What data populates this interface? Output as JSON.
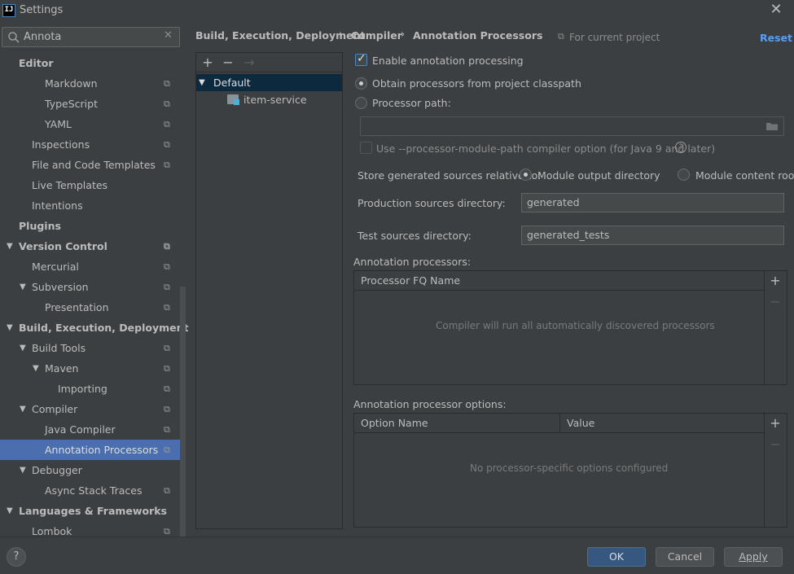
{
  "window": {
    "title": "Settings",
    "app_icon_text": "IJ"
  },
  "search": {
    "value": "Annota",
    "placeholder": ""
  },
  "sidebar": {
    "items": [
      {
        "label": "Editor",
        "bold": true,
        "level": 0,
        "arrow": "",
        "copy": false
      },
      {
        "label": "Markdown",
        "bold": false,
        "level": 2,
        "arrow": "",
        "copy": true
      },
      {
        "label": "TypeScript",
        "bold": false,
        "level": 2,
        "arrow": "",
        "copy": true
      },
      {
        "label": "YAML",
        "bold": false,
        "level": 2,
        "arrow": "",
        "copy": true
      },
      {
        "label": "Inspections",
        "bold": false,
        "level": 1,
        "arrow": "",
        "copy": true
      },
      {
        "label": "File and Code Templates",
        "bold": false,
        "level": 1,
        "arrow": "",
        "copy": true
      },
      {
        "label": "Live Templates",
        "bold": false,
        "level": 1,
        "arrow": "",
        "copy": false
      },
      {
        "label": "Intentions",
        "bold": false,
        "level": 1,
        "arrow": "",
        "copy": false
      },
      {
        "label": "Plugins",
        "bold": true,
        "level": 0,
        "arrow": "",
        "copy": false
      },
      {
        "label": "Version Control",
        "bold": true,
        "level": 0,
        "arrow": "▼",
        "copy": true
      },
      {
        "label": "Mercurial",
        "bold": false,
        "level": 1,
        "arrow": "",
        "copy": true
      },
      {
        "label": "Subversion",
        "bold": false,
        "level": 1,
        "arrow": "▼",
        "copy": true
      },
      {
        "label": "Presentation",
        "bold": false,
        "level": 2,
        "arrow": "",
        "copy": true
      },
      {
        "label": "Build, Execution, Deployment",
        "bold": true,
        "level": 0,
        "arrow": "▼",
        "copy": false
      },
      {
        "label": "Build Tools",
        "bold": false,
        "level": 1,
        "arrow": "▼",
        "copy": true
      },
      {
        "label": "Maven",
        "bold": false,
        "level": 2,
        "arrow": "▼",
        "copy": true
      },
      {
        "label": "Importing",
        "bold": false,
        "level": 3,
        "arrow": "",
        "copy": true
      },
      {
        "label": "Compiler",
        "bold": false,
        "level": 1,
        "arrow": "▼",
        "copy": true
      },
      {
        "label": "Java Compiler",
        "bold": false,
        "level": 2,
        "arrow": "",
        "copy": true
      },
      {
        "label": "Annotation Processors",
        "bold": false,
        "level": 2,
        "arrow": "",
        "copy": true,
        "selected": true
      },
      {
        "label": "Debugger",
        "bold": false,
        "level": 1,
        "arrow": "▼",
        "copy": false
      },
      {
        "label": "Async Stack Traces",
        "bold": false,
        "level": 2,
        "arrow": "",
        "copy": true
      },
      {
        "label": "Languages & Frameworks",
        "bold": true,
        "level": 0,
        "arrow": "▼",
        "copy": false
      },
      {
        "label": "Lombok",
        "bold": false,
        "level": 1,
        "arrow": "",
        "copy": true
      }
    ]
  },
  "breadcrumb": {
    "items": [
      "Build, Execution, Deployment",
      "Compiler",
      "Annotation Processors"
    ],
    "separator": "›",
    "scope_label": "For current project",
    "reset_label": "Reset"
  },
  "profiles": {
    "toolbar": {
      "add": "+",
      "remove": "−",
      "move": "→"
    },
    "default_label": "Default",
    "module_label": "item-service"
  },
  "options": {
    "enable_label": "Enable annotation processing",
    "enable_checked": true,
    "obtain_label": "Obtain processors from project classpath",
    "processor_path_label": "Processor path:",
    "processor_path_value": "",
    "module_path_label": "Use --processor-module-path compiler option (for Java 9 and later)",
    "store_label": "Store generated sources relative to:",
    "store_option_1": "Module output directory",
    "store_option_2": "Module content root",
    "production_label": "Production sources directory:",
    "production_value": "generated",
    "test_label": "Test sources directory:",
    "test_value": "generated_tests"
  },
  "processors_table": {
    "title": "Annotation processors:",
    "column": "Processor FQ Name",
    "empty_text": "Compiler will run all automatically discovered processors"
  },
  "options_table": {
    "title": "Annotation processor options:",
    "columns": [
      "Option Name",
      "Value"
    ],
    "empty_text": "No processor-specific options configured"
  },
  "footer": {
    "help_label": "?",
    "ok_label": "OK",
    "cancel_label": "Cancel",
    "apply_label": "Apply"
  },
  "colors": {
    "accent": "#4b6eaf",
    "link": "#589df6",
    "background": "#3c3f41"
  }
}
